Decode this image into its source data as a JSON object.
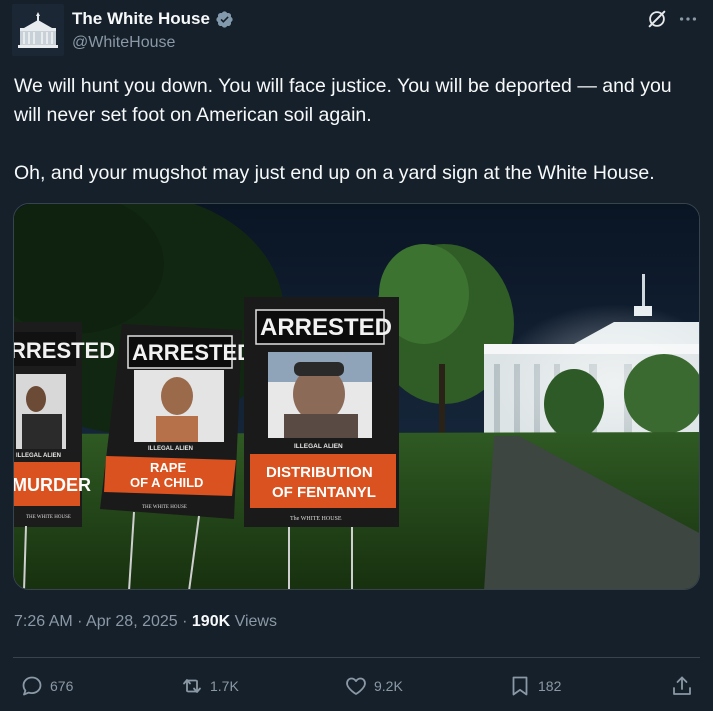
{
  "account": {
    "display_name": "The White House",
    "handle": "@WhiteHouse",
    "verified_icon": "verified-badge-icon",
    "avatar_icon": "white-house-logo"
  },
  "tweet": {
    "text": "We will hunt you down. You will face justice. You will be deported — and you will never set foot on American soil again.\n\nOh, and your mugshot may just end up on a yard sign at the White House."
  },
  "media": {
    "signs": [
      {
        "header": "RRESTED",
        "label": "ILLEGAL ALIEN",
        "crime_line1": "MURDER",
        "crime_line2": "",
        "footer": "THE WHITE HOUSE"
      },
      {
        "header": "ARRESTED",
        "label": "ILLEGAL ALIEN",
        "crime_line1": "RAPE",
        "crime_line2": "OF A CHILD",
        "footer": "THE WHITE HOUSE"
      },
      {
        "header": "ARRESTED",
        "label": "ILLEGAL ALIEN",
        "crime_line1": "DISTRIBUTION",
        "crime_line2": "OF FENTANYL",
        "footer": "The WHITE HOUSE"
      }
    ]
  },
  "meta": {
    "time": "7:26 AM",
    "separator": " · ",
    "date": "Apr 28, 2025",
    "views_count": "190K",
    "views_label": "Views"
  },
  "actions": {
    "replies": "676",
    "reposts": "1.7K",
    "likes": "9.2K",
    "bookmarks": "182"
  },
  "colors": {
    "background": "#15202b",
    "primary_text": "#f7f9f9",
    "secondary_text": "#8b98a5",
    "border": "#38444d",
    "verified": "#829aab",
    "sign_orange": "#d9521f"
  }
}
